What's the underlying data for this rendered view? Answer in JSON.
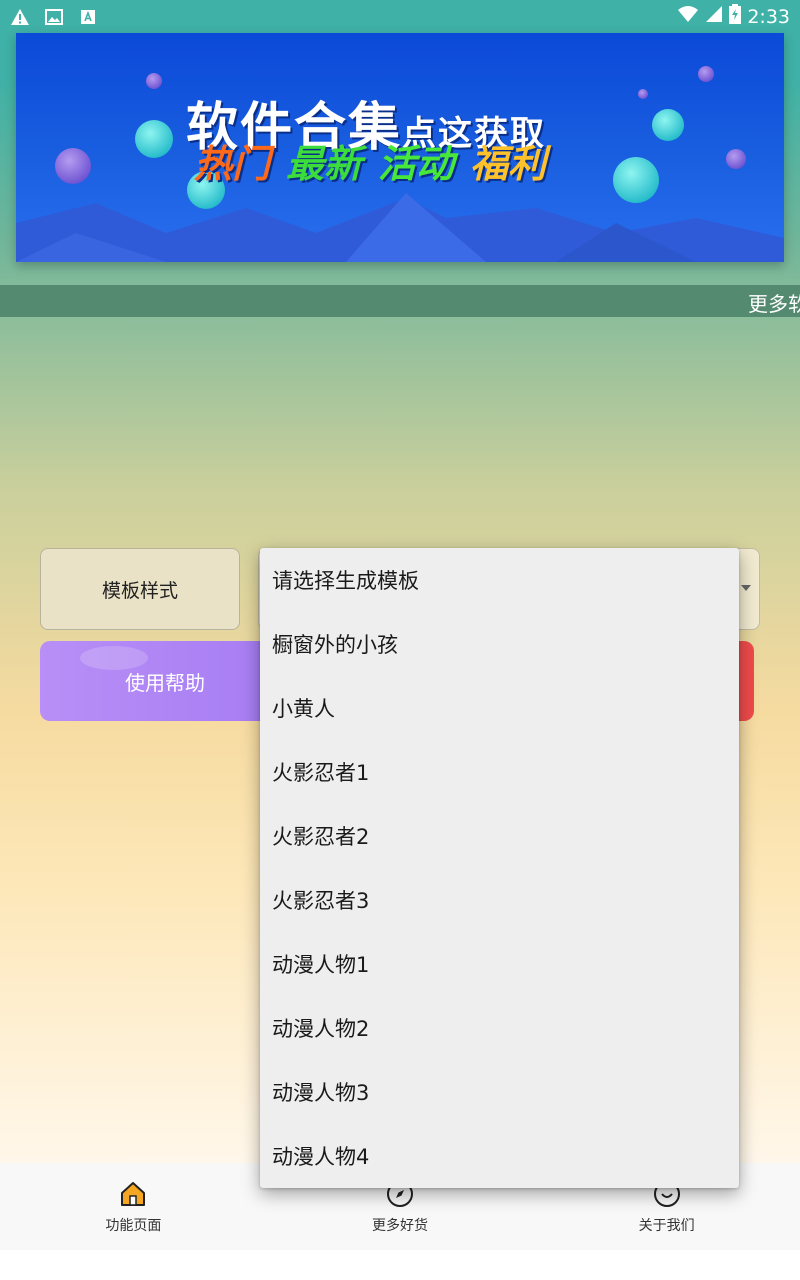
{
  "status_bar": {
    "time": "2:33",
    "icons": [
      "warning-icon",
      "image-icon",
      "a-icon",
      "wifi-icon",
      "signal-icon",
      "battery-icon"
    ]
  },
  "banner": {
    "title": "软件合集",
    "title_suffix": "点这获取",
    "tags": [
      "热门",
      "最新",
      "活动",
      "福利"
    ]
  },
  "marquee": {
    "text": "更多软"
  },
  "controls": {
    "template_label": "模板样式",
    "help_button": "使用帮助"
  },
  "dropdown": {
    "options": [
      "请选择生成模板",
      "橱窗外的小孩",
      "小黄人",
      "火影忍者1",
      "火影忍者2",
      "火影忍者3",
      "动漫人物1",
      "动漫人物2",
      "动漫人物3",
      "动漫人物4"
    ]
  },
  "bottom_nav": {
    "items": [
      {
        "label": "功能页面",
        "icon": "home-icon"
      },
      {
        "label": "更多好货",
        "icon": "compass-icon"
      },
      {
        "label": "关于我们",
        "icon": "smile-icon"
      }
    ]
  },
  "colors": {
    "status_bar": "#3fb1a6",
    "marquee_bg": "#548a70",
    "help_button": "#b08af5",
    "accent_red": "#ef4b4b",
    "home_icon": "#f5a623"
  }
}
